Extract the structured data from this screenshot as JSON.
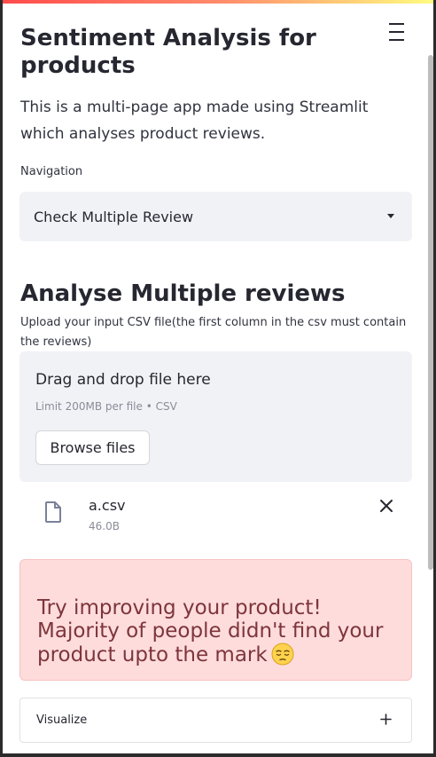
{
  "header": {
    "title": "Sentiment Analysis for products",
    "intro": "This is a multi-page app made using Streamlit which analyses product reviews.",
    "menu_icon": "hamburger-menu-icon"
  },
  "navigation": {
    "label": "Navigation",
    "selected": "Check Multiple Review",
    "dropdown_icon": "caret-down-icon"
  },
  "main": {
    "heading": "Analyse Multiple reviews",
    "upload_label": "Upload your input CSV file(the first column in the csv must contain the reviews)",
    "dropzone": {
      "title": "Drag and drop file here",
      "limit": "Limit 200MB per file • CSV",
      "browse_label": "Browse files"
    },
    "file": {
      "name": "a.csv",
      "size": "46.0B",
      "icon": "file-icon",
      "remove_icon": "close-icon"
    },
    "alert": {
      "text": "Try improving your product! Majority of people didn't find your product upto the mark",
      "emoji": "pensive-face"
    },
    "expander": {
      "label": "Visualize",
      "icon": "plus-icon"
    }
  },
  "colors": {
    "accent_gradient_start": "#ff4b4b",
    "accent_gradient_end": "#fffd80",
    "alert_background": "#ffdcdc",
    "alert_text": "#7d353b",
    "input_background": "#f0f2f6"
  }
}
